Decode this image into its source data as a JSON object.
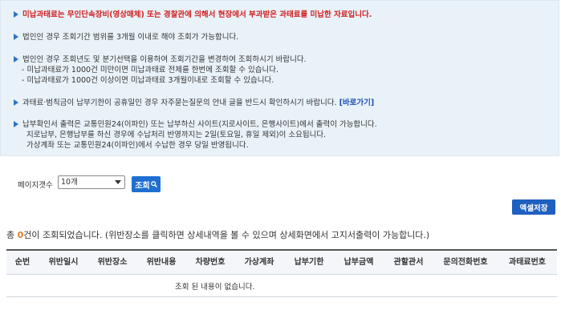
{
  "notice": {
    "lines": [
      "미납과태료는 무인단속장비(영상매체) 또는 경찰관에 의해서 현장에서 부과받은 과태료를 미납한 자료입니다.",
      "법인인 경우 조회기간 범위를 3개월 이내로 해야 조회가 가능합니다.",
      "법인인 경우 조회년도 및 분기선택을 이용하여 조회기간을 변경하여 조회하시기 바랍니다.",
      "- 미납과태료가 1000건 미만이면 미납과태료 전체를 한번에 조회할 수 있습니다.",
      "- 미납과태료가 1000건 이상이면 미납과태료 3개월이내로 조회할 수 있습니다.",
      "과태료·범칙금이 납부기한이 공휴일인 경우 자주묻는질문의 안내 글을 반드시 확인하시기 바랍니다.",
      "[바로가기]",
      "납부확인서 출력은 교통민원24(이파인) 또는 납부하신 사이트(지로사이트, 은행사이트)에서 출력이 가능합니다.",
      "지로납부, 은행납부를 하신 경우에 수납처리 반영까지는 2일(토요일, 휴일 제외)이 소요됩니다.",
      "가상계좌 또는 교통민원24(이파인)에서 수납한 경우 당일 반영됩니다."
    ]
  },
  "pager": {
    "label": "페이지갯수",
    "selected": "10개"
  },
  "buttons": {
    "query": "조회",
    "excel": "엑셀저장"
  },
  "result": {
    "prefix": "총 ",
    "count": "0",
    "suffix": "건이 조회되었습니다. (위반장소를 클릭하면 상세내역을 볼 수 있으며 상세화면에서 고지서출력이 가능합니다.)"
  },
  "table": {
    "headers": [
      "순번",
      "위반일시",
      "위반장소",
      "위반내용",
      "차량번호",
      "가상계좌",
      "납부기한",
      "납부금액",
      "관할관서",
      "문의전화번호",
      "과태료번호"
    ],
    "empty": "조회 된 내용이 없습니다."
  },
  "colors": {
    "notice_bg": "#e9f2f9",
    "accent_red": "#d12020",
    "button_blue": "#1f6fd1",
    "count_orange": "#e07a1f"
  }
}
